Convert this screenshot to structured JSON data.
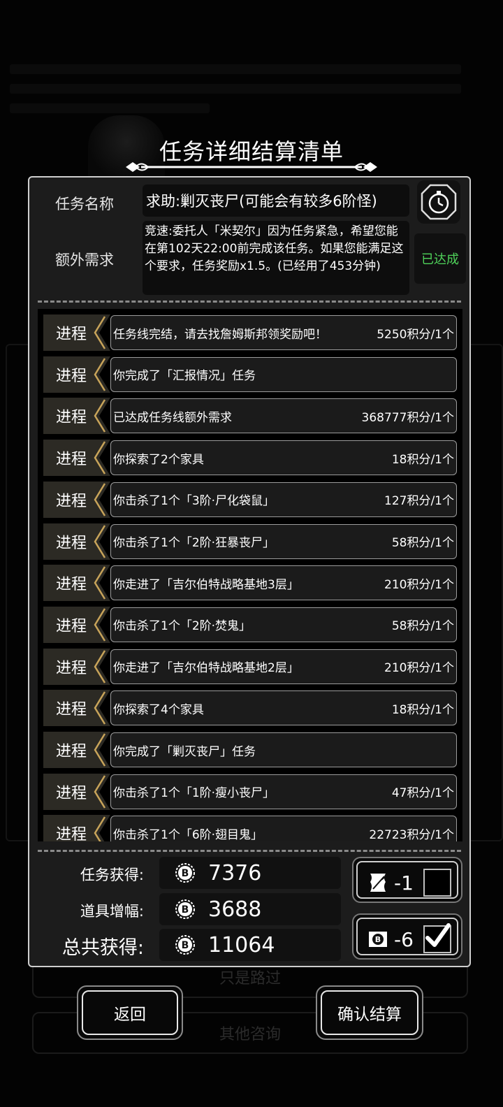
{
  "background": {
    "buttons": [
      {
        "label": "只是路过"
      },
      {
        "label": "其他咨询"
      }
    ]
  },
  "modal": {
    "title": "任务详细结算清单",
    "task_name_label": "任务名称",
    "task_name": "求助:剿灭丧尸(可能会有较多6阶怪)",
    "extra_label": "额外需求",
    "extra_text": "竞速:委托人「米契尔」因为任务紧急，希望您能在第102天22:00前完成该任务。如果您能满足这个要求，任务奖励x1.5。(已经用了453分钟)",
    "achieved": "已达成",
    "timer_icon": "stopwatch-icon"
  },
  "log": {
    "tag_label": "进程",
    "rows": [
      {
        "desc": "任务线完结，请去找詹姆斯邦领奖励吧！",
        "points": "5250积分/1个"
      },
      {
        "desc": "你完成了「汇报情况」任务",
        "points": ""
      },
      {
        "desc": "已达成任务线额外需求",
        "points": "368777积分/1个"
      },
      {
        "desc": "你探索了2个家具",
        "points": "18积分/1个"
      },
      {
        "desc": "你击杀了1个「3阶·尸化袋鼠」",
        "points": "127积分/1个"
      },
      {
        "desc": "你击杀了1个「2阶·狂暴丧尸」",
        "points": "58积分/1个"
      },
      {
        "desc": "你走进了「吉尔伯特战略基地3层」",
        "points": "210积分/1个"
      },
      {
        "desc": "你击杀了1个「2阶·焚鬼」",
        "points": "58积分/1个"
      },
      {
        "desc": "你走进了「吉尔伯特战略基地2层」",
        "points": "210积分/1个"
      },
      {
        "desc": "你探索了4个家具",
        "points": "18积分/1个"
      },
      {
        "desc": "你完成了「剿灭丧尸」任务",
        "points": ""
      },
      {
        "desc": "你击杀了1个「1阶·瘦小丧尸」",
        "points": "47积分/1个"
      },
      {
        "desc": "你击杀了1个「6阶·翅目鬼」",
        "points": "22723积分/1个"
      }
    ]
  },
  "summary": {
    "task_label": "任务获得:",
    "task_value": "7376",
    "item_label": "道具增幅:",
    "item_value": "3688",
    "total_label": "总共获得:",
    "total_value": "11064",
    "coin_icon": "bitcoin-coin-icon"
  },
  "items": [
    {
      "icon": "scroll-quill-icon",
      "count": "-1",
      "checked": false
    },
    {
      "icon": "coin-card-icon",
      "count": "-6",
      "checked": true
    }
  ],
  "buttons": {
    "back": "返回",
    "confirm": "确认结算"
  },
  "colors": {
    "achieved_green": "#4fd35a",
    "tag_gold": "#c8a45a",
    "panel": "#1c1c1c"
  }
}
